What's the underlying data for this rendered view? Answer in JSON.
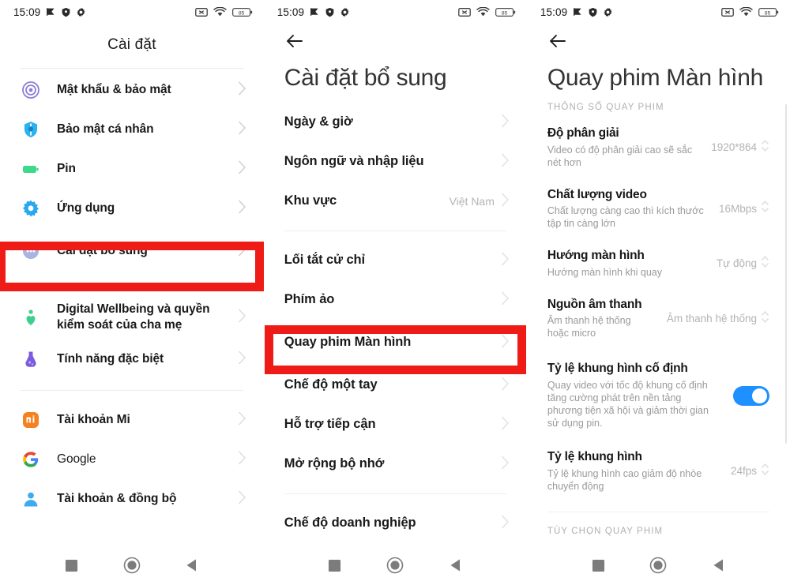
{
  "status_bar": {
    "time": "15:09",
    "left_icons": [
      "location-arrow-icon",
      "shield-icon",
      "gear-icon"
    ],
    "right_icons": [
      "no-sim-icon",
      "wifi-icon",
      "battery-icon"
    ],
    "battery_level": "85"
  },
  "nav_bar": {
    "recents_label": "recents-button",
    "home_label": "home-button",
    "back_label": "back-button"
  },
  "colors": {
    "highlight_red": "#ef1b16",
    "toggle_on": "#1e90ff",
    "title_gray": "#333333",
    "subtext_gray": "#9a9a9a"
  },
  "panel1": {
    "title": "Cài đặt",
    "items": [
      {
        "label": "Mật khẩu & bảo mật",
        "icon": "fingerprint-icon",
        "value": "",
        "highlighted": false
      },
      {
        "label": "Bảo mật cá nhân",
        "icon": "privacy-shield-icon",
        "value": "",
        "highlighted": false
      },
      {
        "label": "Pin",
        "icon": "battery-icon",
        "value": "",
        "highlighted": false
      },
      {
        "label": "Ứng dụng",
        "icon": "apps-gear-icon",
        "value": "",
        "highlighted": false
      },
      {
        "label": "Cài đặt bổ sung",
        "icon": "more-dots-icon",
        "value": "",
        "highlighted": true
      }
    ],
    "items2": [
      {
        "label": "Digital Wellbeing và quyền kiểm soát của cha mẹ",
        "icon": "wellbeing-heart-icon",
        "value": ""
      },
      {
        "label": "Tính năng đặc biệt",
        "icon": "special-features-icon",
        "value": ""
      }
    ],
    "items3": [
      {
        "label": "Tài khoản Mi",
        "icon": "mi-account-icon",
        "value": ""
      },
      {
        "label": "Google",
        "icon": "google-icon",
        "value": ""
      },
      {
        "label": "Tài khoản & đồng bộ",
        "icon": "account-sync-icon",
        "value": ""
      }
    ]
  },
  "panel2": {
    "title": "Cài đặt bổ sung",
    "back_icon": "back-arrow-icon",
    "group1": [
      {
        "label": "Ngày & giờ",
        "value": ""
      },
      {
        "label": "Ngôn ngữ và nhập liệu",
        "value": ""
      },
      {
        "label": "Khu vực",
        "value": "Việt Nam"
      }
    ],
    "group2": [
      {
        "label": "Lối tắt cử chỉ",
        "value": "",
        "highlighted": false
      },
      {
        "label": "Phím ảo",
        "value": "",
        "highlighted": false
      },
      {
        "label": "Quay phim Màn hình",
        "value": "",
        "highlighted": true
      },
      {
        "label": "Chế độ một tay",
        "value": "",
        "highlighted": false
      },
      {
        "label": "Hỗ trợ tiếp cận",
        "value": "",
        "highlighted": false
      },
      {
        "label": "Mở rộng bộ nhớ",
        "value": "",
        "highlighted": false
      }
    ],
    "group3": [
      {
        "label": "Chế độ doanh nghiệp",
        "value": ""
      }
    ]
  },
  "panel3": {
    "title": "Quay phim Màn hình",
    "back_icon": "back-arrow-icon",
    "section1_label": "THÔNG SỐ QUAY PHIM",
    "section2_label": "TÙY CHỌN QUAY PHIM",
    "settings": [
      {
        "title": "Độ phân giải",
        "sub": "Video có độ phân giải cao sẽ sắc nét hơn",
        "value": "1920*864",
        "control": "stepper"
      },
      {
        "title": "Chất lượng video",
        "sub": "Chất lượng càng cao thì kích thước tập tin càng lớn",
        "value": "16Mbps",
        "control": "stepper"
      },
      {
        "title": "Hướng màn hình",
        "sub": "Hướng màn hình khi quay",
        "value": "Tự động",
        "control": "stepper"
      },
      {
        "title": "Nguồn âm thanh",
        "sub": "Âm thanh hệ thống hoặc micro",
        "value": "Âm thanh hệ thống",
        "control": "stepper"
      },
      {
        "title": "Tỷ lệ khung hình cố định",
        "sub": "Quay video với tốc độ khung cố định tăng cường phát trên nền tảng phương tiện xã hội và giảm thời gian sử dụng pin.",
        "value": "",
        "control": "toggle",
        "toggle_on": true
      },
      {
        "title": "Tỷ lệ khung hình",
        "sub": "Tỷ lệ khung hình cao giảm độ nhòe chuyển động",
        "value": "24fps",
        "control": "stepper"
      }
    ]
  }
}
